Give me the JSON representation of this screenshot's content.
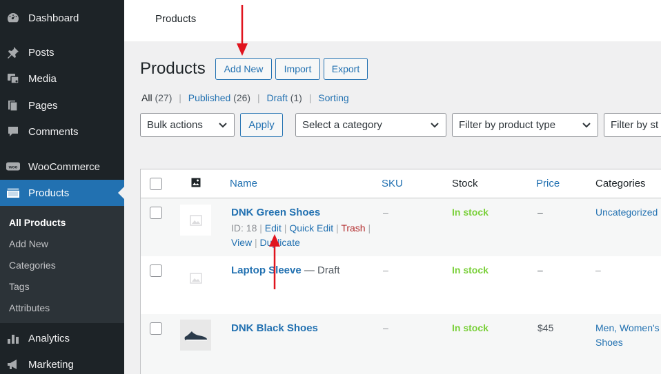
{
  "sidebar": {
    "items": [
      {
        "label": "Dashboard",
        "icon": "dashboard-icon"
      },
      {
        "label": "Posts",
        "icon": "pin-icon"
      },
      {
        "label": "Media",
        "icon": "media-icon"
      },
      {
        "label": "Pages",
        "icon": "pages-icon"
      },
      {
        "label": "Comments",
        "icon": "comment-icon"
      },
      {
        "label": "WooCommerce",
        "icon": "woo-icon"
      },
      {
        "label": "Products",
        "icon": "archive-icon"
      },
      {
        "label": "Analytics",
        "icon": "chart-bar-icon"
      },
      {
        "label": "Marketing",
        "icon": "megaphone-icon"
      }
    ],
    "submenu": [
      "All Products",
      "Add New",
      "Categories",
      "Tags",
      "Attributes"
    ]
  },
  "topbar": {
    "title": "Products"
  },
  "page": {
    "title": "Products",
    "buttons": {
      "add_new": "Add New",
      "import": "Import",
      "export": "Export"
    }
  },
  "views": {
    "all": "All",
    "all_count": "(27)",
    "published": "Published",
    "published_count": "(26)",
    "draft": "Draft",
    "draft_count": "(1)",
    "sorting": "Sorting",
    "separator": "|"
  },
  "filters": {
    "bulk_actions": "Bulk actions",
    "apply": "Apply",
    "category": "Select a category",
    "product_type": "Filter by product type",
    "stock": "Filter by st"
  },
  "table": {
    "columns": {
      "name": "Name",
      "sku": "SKU",
      "stock": "Stock",
      "price": "Price",
      "categories": "Categories"
    },
    "rows": [
      {
        "name": "DNK Green Shoes",
        "state": "",
        "row_actions": {
          "id": "ID: 18",
          "edit": "Edit",
          "quick_edit": "Quick Edit",
          "trash": "Trash",
          "view": "View",
          "duplicate": "Duplicate",
          "sep": "|"
        },
        "sku": "–",
        "stock": "In stock",
        "price": "–",
        "categories": "Uncategorized"
      },
      {
        "name": "Laptop Sleeve",
        "state": " — Draft",
        "sku": "–",
        "stock": "In stock",
        "price": "–",
        "categories": "–"
      },
      {
        "name": "DNK Black Shoes",
        "state": "",
        "sku": "–",
        "stock": "In stock",
        "price": "$45",
        "categories": "Men, Women's Shoes"
      }
    ]
  },
  "colors": {
    "accent": "#2271b1",
    "sidebar": "#1d2327",
    "in_stock": "#7ad03a",
    "trash": "#b32d2e",
    "annotation": "#e0141e"
  }
}
